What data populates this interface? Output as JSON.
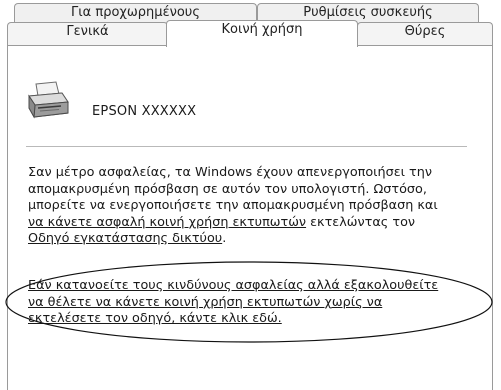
{
  "tabs": [
    {
      "label": "Για προχωρημένους"
    },
    {
      "label": "Ρυθμίσεις συσκευής"
    },
    {
      "label": "Γενικά"
    },
    {
      "label": "Κοινή χρήση"
    },
    {
      "label": "Θύρες"
    }
  ],
  "printer": {
    "name": "EPSON XXXXXX",
    "icon": "printer-icon"
  },
  "info": {
    "line1": "Σαν μέτρο ασφαλείας, τα Windows έχουν απενεργοποιήσει την\nαπομακρυσμένη πρόσβαση σε αυτόν τον υπολογιστή. Ωστόσο,\nμπορείτε να ενεργοποιήσετε την απομακρυσμένη πρόσβαση και\n",
    "link1": "να κάνετε ασφαλή κοινή χρήση εκτυπωτών",
    "mid": " εκτελώντας τον\n",
    "link2": "Οδηγό εγκατάστασης δικτύου",
    "end": "."
  },
  "risk_link": "Εάν κατανοείτε τους κινδύνους ασφαλείας αλλά εξακολουθείτε\nνα θέλετε να κάνετε κοινή χρήση εκτυπωτών χωρίς να\nεκτελέσετε τον οδηγό, κάντε κλικ εδώ."
}
